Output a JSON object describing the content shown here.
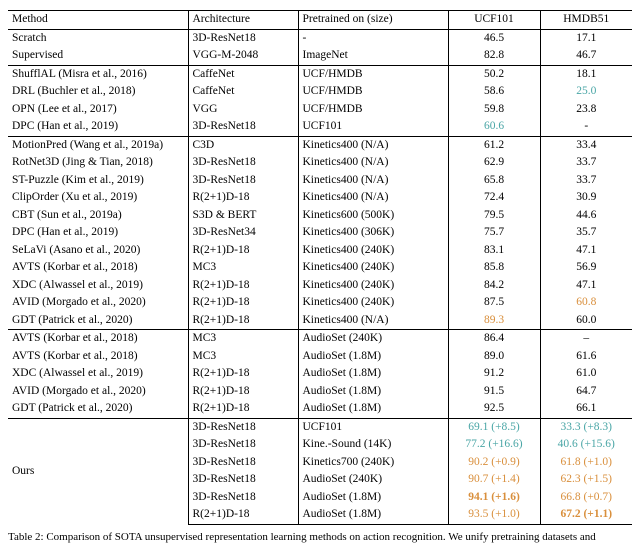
{
  "columns": [
    "Method",
    "Architecture",
    "Pretrained on (size)",
    "UCF101",
    "HMDB51"
  ],
  "sections": [
    {
      "rows": [
        {
          "method": "Scratch",
          "arch": "3D-ResNet18",
          "pre": "-",
          "ucf": {
            "v": "46.5"
          },
          "hmdb": {
            "v": "17.1"
          }
        },
        {
          "method": "Supervised",
          "arch": "VGG-M-2048",
          "pre": "ImageNet",
          "ucf": {
            "v": "82.8"
          },
          "hmdb": {
            "v": "46.7"
          }
        }
      ]
    },
    {
      "rows": [
        {
          "method": "ShufflAL (Misra et al., 2016)",
          "arch": "CaffeNet",
          "pre": "UCF/HMDB",
          "ucf": {
            "v": "50.2"
          },
          "hmdb": {
            "v": "18.1"
          }
        },
        {
          "method": "DRL (Buchler et al., 2018)",
          "arch": "CaffeNet",
          "pre": "UCF/HMDB",
          "ucf": {
            "v": "58.6"
          },
          "hmdb": {
            "v": "25.0",
            "c": "teal"
          }
        },
        {
          "method": "OPN (Lee et al., 2017)",
          "arch": "VGG",
          "pre": "UCF/HMDB",
          "ucf": {
            "v": "59.8"
          },
          "hmdb": {
            "v": "23.8"
          }
        },
        {
          "method": "DPC (Han et al., 2019)",
          "arch": "3D-ResNet18",
          "pre": "UCF101",
          "ucf": {
            "v": "60.6",
            "c": "teal"
          },
          "hmdb": {
            "v": "-"
          }
        }
      ]
    },
    {
      "rows": [
        {
          "method": "MotionPred (Wang et al., 2019a)",
          "arch": "C3D",
          "pre": "Kinetics400 (N/A)",
          "ucf": {
            "v": "61.2"
          },
          "hmdb": {
            "v": "33.4"
          }
        },
        {
          "method": "RotNet3D (Jing & Tian, 2018)",
          "arch": "3D-ResNet18",
          "pre": "Kinetics400 (N/A)",
          "ucf": {
            "v": "62.9"
          },
          "hmdb": {
            "v": "33.7"
          }
        },
        {
          "method": "ST-Puzzle (Kim et al., 2019)",
          "arch": "3D-ResNet18",
          "pre": "Kinetics400 (N/A)",
          "ucf": {
            "v": "65.8"
          },
          "hmdb": {
            "v": "33.7"
          }
        },
        {
          "method": "ClipOrder (Xu et al., 2019)",
          "arch": "R(2+1)D-18",
          "pre": "Kinetics400 (N/A)",
          "ucf": {
            "v": "72.4"
          },
          "hmdb": {
            "v": "30.9"
          }
        },
        {
          "method": "CBT (Sun et al., 2019a)",
          "arch": "S3D & BERT",
          "pre": "Kinetics600 (500K)",
          "ucf": {
            "v": "79.5"
          },
          "hmdb": {
            "v": "44.6"
          }
        },
        {
          "method": "DPC (Han et al., 2019)",
          "arch": "3D-ResNet34",
          "pre": "Kinetics400 (306K)",
          "ucf": {
            "v": "75.7"
          },
          "hmdb": {
            "v": "35.7"
          }
        },
        {
          "method": "SeLaVi (Asano et al., 2020)",
          "arch": "R(2+1)D-18",
          "pre": "Kinetics400 (240K)",
          "ucf": {
            "v": "83.1"
          },
          "hmdb": {
            "v": "47.1"
          }
        },
        {
          "method": "AVTS (Korbar et al., 2018)",
          "arch": "MC3",
          "pre": "Kinetics400 (240K)",
          "ucf": {
            "v": "85.8"
          },
          "hmdb": {
            "v": "56.9"
          }
        },
        {
          "method": "XDC (Alwassel et al., 2019)",
          "arch": "R(2+1)D-18",
          "pre": "Kinetics400 (240K)",
          "ucf": {
            "v": "84.2"
          },
          "hmdb": {
            "v": "47.1"
          }
        },
        {
          "method": "AVID (Morgado et al., 2020)",
          "arch": "R(2+1)D-18",
          "pre": "Kinetics400 (240K)",
          "ucf": {
            "v": "87.5"
          },
          "hmdb": {
            "v": "60.8",
            "c": "orange"
          }
        },
        {
          "method": "GDT (Patrick et al., 2020)",
          "arch": "R(2+1)D-18",
          "pre": "Kinetics400 (N/A)",
          "ucf": {
            "v": "89.3",
            "c": "orange"
          },
          "hmdb": {
            "v": "60.0"
          }
        }
      ]
    },
    {
      "rows": [
        {
          "method": "AVTS (Korbar et al., 2018)",
          "arch": "MC3",
          "pre": "AudioSet (240K)",
          "ucf": {
            "v": "86.4"
          },
          "hmdb": {
            "v": "–"
          }
        },
        {
          "method": "AVTS (Korbar et al., 2018)",
          "arch": "MC3",
          "pre": "AudioSet (1.8M)",
          "ucf": {
            "v": "89.0"
          },
          "hmdb": {
            "v": "61.6"
          }
        },
        {
          "method": "XDC (Alwassel et al., 2019)",
          "arch": "R(2+1)D-18",
          "pre": "AudioSet (1.8M)",
          "ucf": {
            "v": "91.2"
          },
          "hmdb": {
            "v": "61.0"
          }
        },
        {
          "method": "AVID (Morgado et al., 2020)",
          "arch": "R(2+1)D-18",
          "pre": "AudioSet (1.8M)",
          "ucf": {
            "v": "91.5"
          },
          "hmdb": {
            "v": "64.7"
          }
        },
        {
          "method": "GDT (Patrick et al., 2020)",
          "arch": "R(2+1)D-18",
          "pre": "AudioSet (1.8M)",
          "ucf": {
            "v": "92.5"
          },
          "hmdb": {
            "v": "66.1"
          }
        }
      ]
    },
    {
      "ours_label": "Ours",
      "rows": [
        {
          "arch": "3D-ResNet18",
          "pre": "UCF101",
          "ucf": {
            "v": "69.1 (+8.5)",
            "c": "teal"
          },
          "hmdb": {
            "v": "33.3 (+8.3)",
            "c": "teal"
          }
        },
        {
          "arch": "3D-ResNet18",
          "pre": "Kine.-Sound (14K)",
          "ucf": {
            "v": "77.2 (+16.6)",
            "c": "teal"
          },
          "hmdb": {
            "v": "40.6 (+15.6)",
            "c": "teal"
          }
        },
        {
          "arch": "3D-ResNet18",
          "pre": "Kinetics700 (240K)",
          "ucf": {
            "v": "90.2 (+0.9)",
            "c": "orange"
          },
          "hmdb": {
            "v": "61.8 (+1.0)",
            "c": "orange"
          }
        },
        {
          "arch": "3D-ResNet18",
          "pre": "AudioSet (240K)",
          "ucf": {
            "v": "90.7 (+1.4)",
            "c": "orange"
          },
          "hmdb": {
            "v": "62.3 (+1.5)",
            "c": "orange"
          }
        },
        {
          "arch": "3D-ResNet18",
          "pre": "AudioSet (1.8M)",
          "ucf": {
            "v": "94.1 (+1.6)",
            "c": "orange-bold"
          },
          "hmdb": {
            "v": "66.8 (+0.7)",
            "c": "orange"
          }
        },
        {
          "arch": "R(2+1)D-18",
          "pre": "AudioSet (1.8M)",
          "ucf": {
            "v": "93.5 (+1.0)",
            "c": "orange"
          },
          "hmdb": {
            "v": "67.2 (+1.1)",
            "c": "orange-bold"
          }
        }
      ]
    }
  ],
  "caption_prefix": "Table 2: Comparison of SOTA unsupervised representation learning methods on action recognition. We unify pretraining datasets and"
}
